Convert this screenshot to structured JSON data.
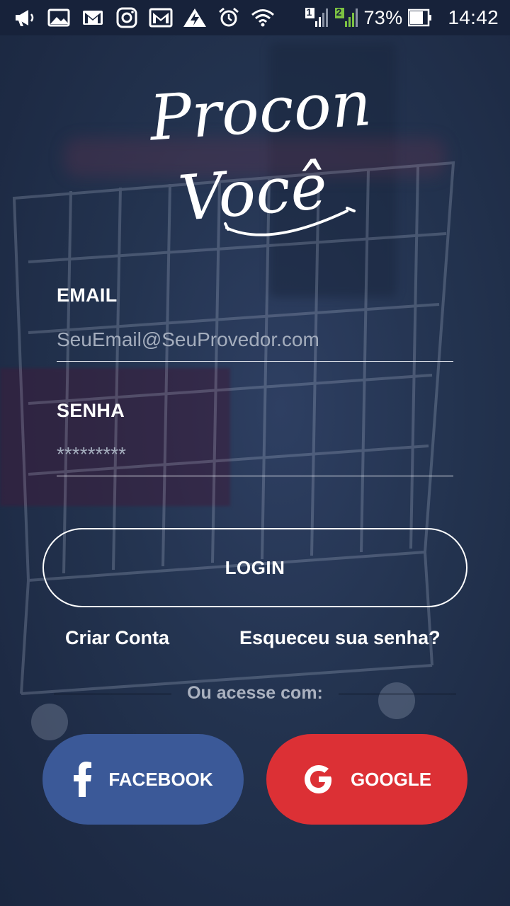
{
  "status_bar": {
    "battery_percent": "73%",
    "time": "14:42",
    "sim1_label": "1",
    "sim2_label": "2",
    "icons": [
      "megaphone-icon",
      "image-icon",
      "gmail-icon",
      "instagram-icon",
      "mail-icon",
      "warning-icon",
      "alarm-icon",
      "wifi-icon",
      "signal-icon",
      "battery-icon"
    ]
  },
  "logo": {
    "line1": "Procon",
    "line2": "Você"
  },
  "form": {
    "email_label": "EMAIL",
    "email_placeholder": "SeuEmail@SeuProvedor.com",
    "password_label": "SENHA",
    "password_placeholder": "*********",
    "login_label": "LOGIN"
  },
  "links": {
    "create_account": "Criar Conta",
    "forgot_password": "Esqueceu sua senha?"
  },
  "social": {
    "divider_text": "Ou acesse com:",
    "facebook_label": "FACEBOOK",
    "google_label": "GOOGLE"
  },
  "colors": {
    "background": "#23334f",
    "facebook": "#3b5998",
    "google": "#dc3035",
    "text": "#ffffff"
  }
}
